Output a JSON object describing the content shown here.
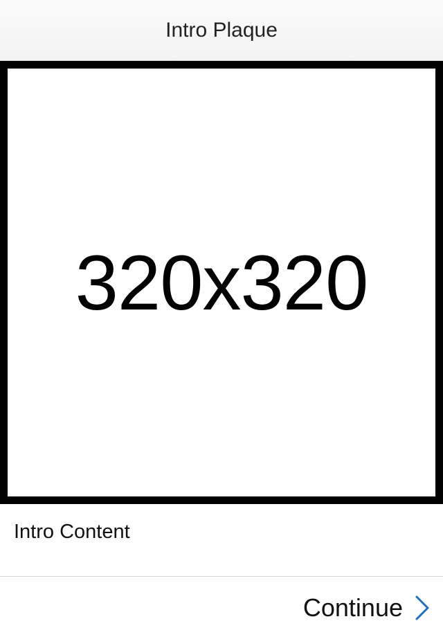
{
  "nav": {
    "title": "Intro Plaque"
  },
  "image_placeholder": {
    "text": "320x320"
  },
  "content": {
    "text": "Intro Content"
  },
  "footer": {
    "continue_label": "Continue",
    "continue_icon": "chevron-right-icon",
    "accent_color": "#1f6fc5"
  }
}
